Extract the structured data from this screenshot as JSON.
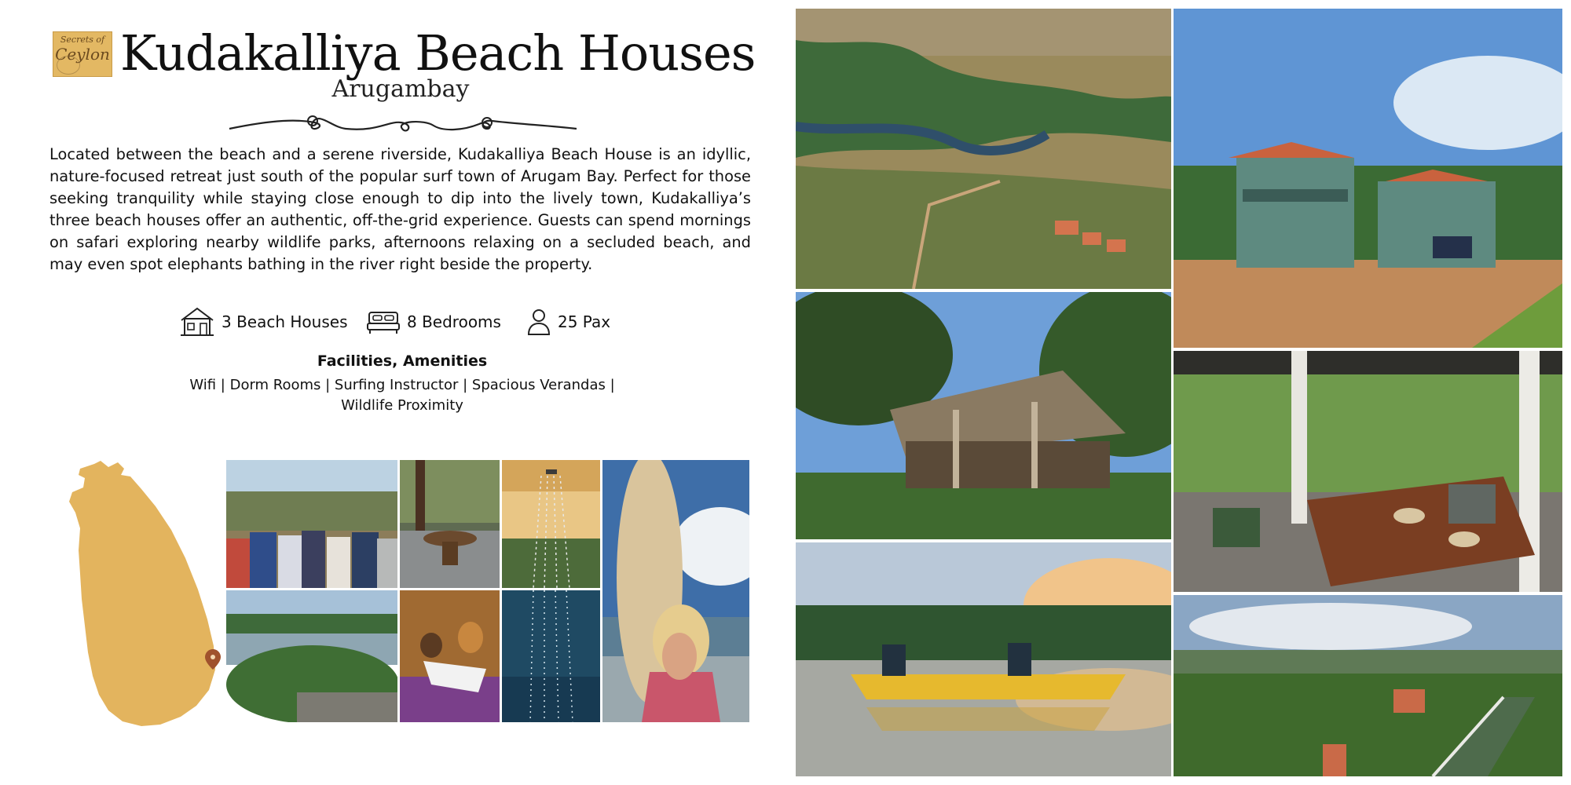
{
  "logo": {
    "line1": "Secrets of",
    "line2": "Ceylon"
  },
  "property": {
    "name": "Kudakalliya Beach Houses",
    "location": "Arugambay",
    "description": "Located between the beach and a serene riverside, Kudakalliya Beach House is an idyllic, nature-focused retreat just south of the popular surf town of Arugam Bay. Perfect for those seeking tranquility while staying close enough to dip into the lively town, Kudakalliya’s three beach houses offer an authentic, off-the-grid experience. Guests can spend mornings on safari exploring nearby wildlife parks, afternoons relaxing on a secluded beach, and may even spot elephants bathing in the river right beside the property."
  },
  "stats": [
    {
      "icon": "house-icon",
      "label": "3 Beach Houses"
    },
    {
      "icon": "bed-icon",
      "label": "8 Bedrooms"
    },
    {
      "icon": "person-icon",
      "label": "25 Pax"
    }
  ],
  "facilities": {
    "title": "Facilities, Amenities",
    "list": "Wifi | Dorm Rooms | Surfing Instructor | Spacious Verandas | Wildlife Proximity"
  },
  "colors": {
    "map_fill": "#e3b45e",
    "map_pin": "#a0522d",
    "text": "#111111"
  }
}
